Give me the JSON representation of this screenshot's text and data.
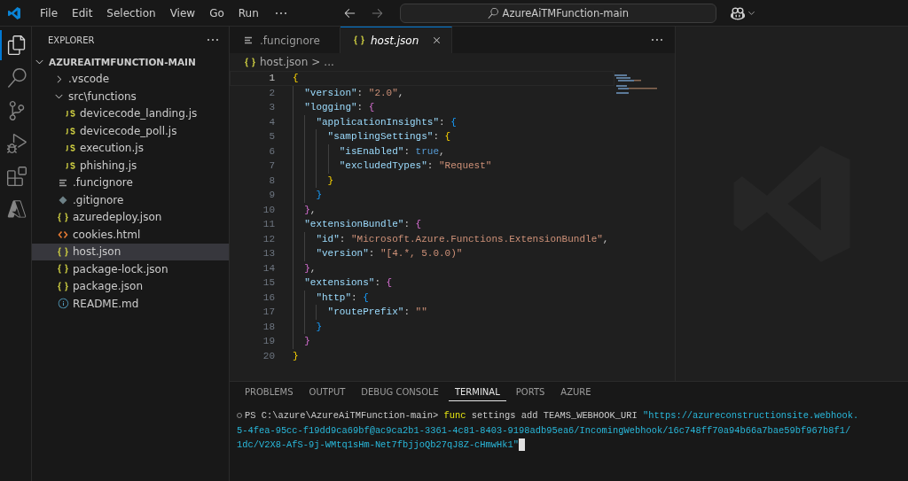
{
  "menu": [
    "File",
    "Edit",
    "Selection",
    "View",
    "Go",
    "Run"
  ],
  "command_center": {
    "text": "AzureAiTMFunction-main"
  },
  "activity_bar": [
    {
      "kind": "explorer",
      "selected": true
    },
    {
      "kind": "search",
      "selected": false
    },
    {
      "kind": "source-control",
      "selected": false
    },
    {
      "kind": "run-debug",
      "selected": false
    },
    {
      "kind": "extensions",
      "selected": false
    },
    {
      "kind": "azure",
      "selected": false
    }
  ],
  "sidebar": {
    "title": "EXPLORER",
    "tree": {
      "label": "AZUREAITMFUNCTION-MAIN",
      "expanded": true,
      "children": [
        {
          "label": ".vscode",
          "kind": "folder",
          "expanded": false,
          "selected": false
        },
        {
          "label": "src\\functions",
          "kind": "folder",
          "expanded": true,
          "selected": false,
          "children": [
            {
              "label": "devicecode_landing.js",
              "kind": "js",
              "selected": false
            },
            {
              "label": "devicecode_poll.js",
              "kind": "js",
              "selected": false
            },
            {
              "label": "execution.js",
              "kind": "js",
              "selected": false
            },
            {
              "label": "phishing.js",
              "kind": "js",
              "selected": false
            }
          ]
        },
        {
          "label": ".funcignore",
          "kind": "text",
          "selected": false
        },
        {
          "label": ".gitignore",
          "kind": "git",
          "selected": false
        },
        {
          "label": "azuredeploy.json",
          "kind": "json",
          "selected": false
        },
        {
          "label": "cookies.html",
          "kind": "html",
          "selected": false
        },
        {
          "label": "host.json",
          "kind": "json",
          "selected": true
        },
        {
          "label": "package-lock.json",
          "kind": "json",
          "selected": false
        },
        {
          "label": "package.json",
          "kind": "json",
          "selected": false
        },
        {
          "label": "README.md",
          "kind": "info",
          "selected": false
        }
      ]
    }
  },
  "tabs": [
    {
      "label": ".funcignore",
      "kind": "text",
      "selected": false,
      "preview": false
    },
    {
      "label": "host.json",
      "kind": "json",
      "selected": true,
      "preview": true
    }
  ],
  "breadcrumb": {
    "file": "host.json",
    "separator": ">",
    "rest": "..."
  },
  "code": [
    {
      "number": "1",
      "current": true,
      "tokens": [
        {
          "kind": "b1",
          "text": "{"
        }
      ]
    },
    {
      "number": "2",
      "current": false,
      "tokens": [
        {
          "kind": "key",
          "text": "  \"version\""
        },
        {
          "kind": "punct",
          "text": ": "
        },
        {
          "kind": "str",
          "text": "\"2.0\""
        },
        {
          "kind": "punct",
          "text": ","
        }
      ]
    },
    {
      "number": "3",
      "current": false,
      "tokens": [
        {
          "kind": "key",
          "text": "  \"logging\""
        },
        {
          "kind": "punct",
          "text": ": "
        },
        {
          "kind": "b2",
          "text": "{"
        }
      ]
    },
    {
      "number": "4",
      "current": false,
      "tokens": [
        {
          "kind": "key",
          "text": "    \"applicationInsights\""
        },
        {
          "kind": "punct",
          "text": ": "
        },
        {
          "kind": "b3",
          "text": "{"
        }
      ]
    },
    {
      "number": "5",
      "current": false,
      "tokens": [
        {
          "kind": "key",
          "text": "      \"samplingSettings\""
        },
        {
          "kind": "punct",
          "text": ": "
        },
        {
          "kind": "b1",
          "text": "{"
        }
      ]
    },
    {
      "number": "6",
      "current": false,
      "tokens": [
        {
          "kind": "key",
          "text": "        \"isEnabled\""
        },
        {
          "kind": "punct",
          "text": ": "
        },
        {
          "kind": "bool",
          "text": "true"
        },
        {
          "kind": "punct",
          "text": ","
        }
      ]
    },
    {
      "number": "7",
      "current": false,
      "tokens": [
        {
          "kind": "key",
          "text": "        \"excludedTypes\""
        },
        {
          "kind": "punct",
          "text": ": "
        },
        {
          "kind": "str",
          "text": "\"Request\""
        }
      ]
    },
    {
      "number": "8",
      "current": false,
      "tokens": [
        {
          "kind": "b1",
          "text": "      }"
        }
      ]
    },
    {
      "number": "9",
      "current": false,
      "tokens": [
        {
          "kind": "b3",
          "text": "    }"
        }
      ]
    },
    {
      "number": "10",
      "current": false,
      "tokens": [
        {
          "kind": "b2",
          "text": "  }"
        },
        {
          "kind": "punct",
          "text": ","
        }
      ]
    },
    {
      "number": "11",
      "current": false,
      "tokens": [
        {
          "kind": "key",
          "text": "  \"extensionBundle\""
        },
        {
          "kind": "punct",
          "text": ": "
        },
        {
          "kind": "b2",
          "text": "{"
        }
      ]
    },
    {
      "number": "12",
      "current": false,
      "tokens": [
        {
          "kind": "key",
          "text": "    \"id\""
        },
        {
          "kind": "punct",
          "text": ": "
        },
        {
          "kind": "str",
          "text": "\"Microsoft.Azure.Functions.ExtensionBundle\""
        },
        {
          "kind": "punct",
          "text": ","
        }
      ]
    },
    {
      "number": "13",
      "current": false,
      "tokens": [
        {
          "kind": "key",
          "text": "    \"version\""
        },
        {
          "kind": "punct",
          "text": ": "
        },
        {
          "kind": "str",
          "text": "\"[4.*, 5.0.0)\""
        }
      ]
    },
    {
      "number": "14",
      "current": false,
      "tokens": [
        {
          "kind": "b2",
          "text": "  }"
        },
        {
          "kind": "punct",
          "text": ","
        }
      ]
    },
    {
      "number": "15",
      "current": false,
      "tokens": [
        {
          "kind": "key",
          "text": "  \"extensions\""
        },
        {
          "kind": "punct",
          "text": ": "
        },
        {
          "kind": "b2",
          "text": "{"
        }
      ]
    },
    {
      "number": "16",
      "current": false,
      "tokens": [
        {
          "kind": "key",
          "text": "    \"http\""
        },
        {
          "kind": "punct",
          "text": ": "
        },
        {
          "kind": "b3",
          "text": "{"
        }
      ]
    },
    {
      "number": "17",
      "current": false,
      "tokens": [
        {
          "kind": "key",
          "text": "      \"routePrefix\""
        },
        {
          "kind": "punct",
          "text": ": "
        },
        {
          "kind": "str",
          "text": "\"\""
        }
      ]
    },
    {
      "number": "18",
      "current": false,
      "tokens": [
        {
          "kind": "b3",
          "text": "    }"
        }
      ]
    },
    {
      "number": "19",
      "current": false,
      "tokens": [
        {
          "kind": "b2",
          "text": "  }"
        }
      ]
    },
    {
      "number": "20",
      "current": false,
      "tokens": [
        {
          "kind": "b1",
          "text": "}"
        }
      ]
    }
  ],
  "panel": {
    "tabs": [
      {
        "label": "PROBLEMS",
        "selected": false
      },
      {
        "label": "OUTPUT",
        "selected": false
      },
      {
        "label": "DEBUG CONSOLE",
        "selected": false
      },
      {
        "label": "TERMINAL",
        "selected": true
      },
      {
        "label": "PORTS",
        "selected": false
      },
      {
        "label": "AZURE",
        "selected": false
      }
    ],
    "terminal": [
      [
        {
          "kind": "prompt",
          "text": "PS C:\\azure\\AzureAiTMFunction-main> "
        },
        {
          "kind": "cmd",
          "text": "func"
        },
        {
          "kind": "arg",
          "text": " settings add TEAMS_WEBHOOK_URI "
        },
        {
          "kind": "str",
          "text": "\"https://azureconstructionsite.webhook."
        }
      ],
      [
        {
          "kind": "str",
          "text": "5-4fea-95cc-f19dd9ca69bf@ac9ca2b1-3361-4c81-8403-9198adb95ea6/IncomingWebhook/16c748ff70a94b66a7bae59bf967b8f1/"
        }
      ],
      [
        {
          "kind": "str",
          "text": "1dc/V2X8-AfS-9j-WMtq1sHm-Net7fbjjoQb27qJ8Z-cHmwHk1\""
        }
      ]
    ]
  }
}
